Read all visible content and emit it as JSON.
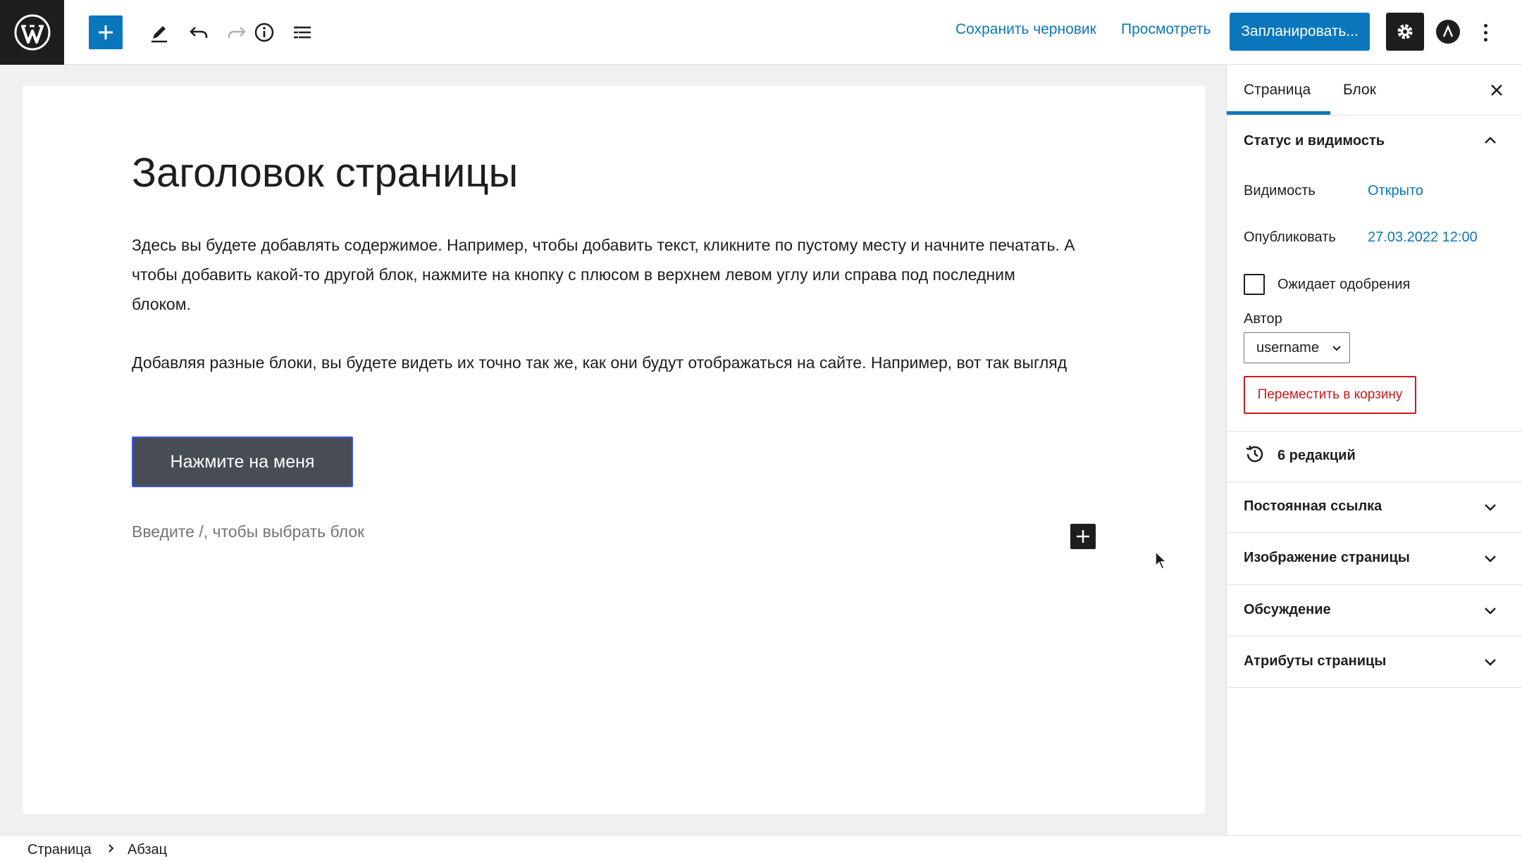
{
  "header": {
    "save_draft": "Сохранить черновик",
    "preview": "Просмотреть",
    "schedule": "Запланировать...",
    "colors": {
      "accent": "#0a77bd",
      "dark": "#1e1e1e"
    }
  },
  "editor": {
    "title": "Заголовок страницы",
    "paragraph1": "Здесь вы будете добавлять содержимое. Например, чтобы добавить текст, кликните по пустому месту и начните печатать. А чтобы добавить какой-то другой блок, нажмите на кнопку с плюсом в верхнем левом углу или справа под последним блоком.",
    "paragraph2": "Добавляя разные блоки, вы будете видеть их точно так же, как они будут отображаться на сайте. Например, вот так выгляд",
    "button_label": "Нажмите на меня",
    "placeholder": "Введите /, чтобы выбрать блок"
  },
  "sidebar": {
    "tabs": [
      "Страница",
      "Блок"
    ],
    "status_panel": {
      "title": "Статус и видимость",
      "visibility_label": "Видимость",
      "visibility_value": "Открыто",
      "publish_label": "Опубликовать",
      "publish_value": "27.03.2022 12:00",
      "pending_label": "Ожидает одобрения",
      "author_label": "Автор",
      "author_value": "username",
      "trash_label": "Переместить в корзину"
    },
    "revisions": "6 редакций",
    "panels": [
      "Постоянная ссылка",
      "Изображение страницы",
      "Обсуждение",
      "Атрибуты страницы"
    ]
  },
  "footer": {
    "breadcrumb": [
      "Страница",
      "Абзац"
    ]
  }
}
